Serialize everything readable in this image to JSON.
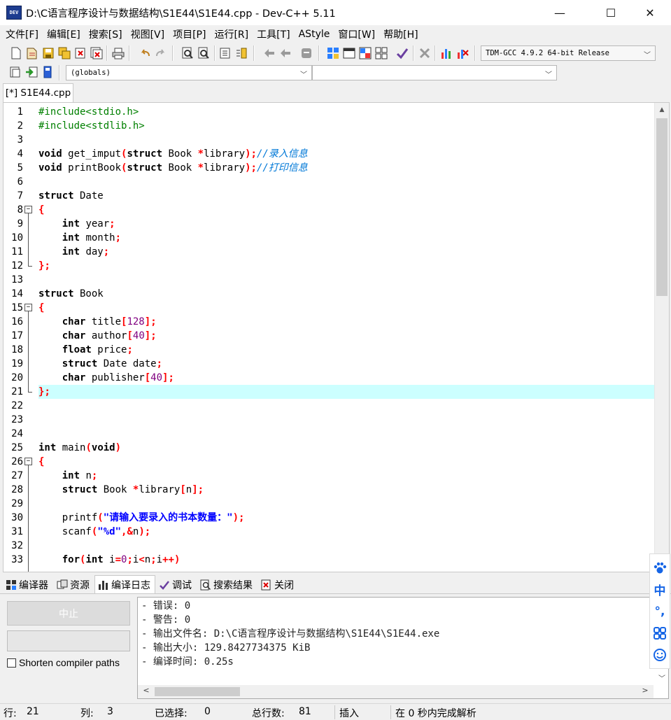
{
  "window": {
    "title": "D:\\C语言程序设计与数据结构\\S1E44\\S1E44.cpp - Dev-C++ 5.11",
    "icon_text": "DEV",
    "minimize": "—",
    "maximize": "☐",
    "close": "✕"
  },
  "menu": [
    "文件[F]",
    "编辑[E]",
    "搜索[S]",
    "视图[V]",
    "项目[P]",
    "运行[R]",
    "工具[T]",
    "AStyle",
    "窗口[W]",
    "帮助[H]"
  ],
  "toolbar": {
    "compiler_selected": "TDM-GCC 4.9.2 64-bit Release",
    "scope_selected": "(globals)",
    "member_selected": ""
  },
  "editor": {
    "tab_label": "[*] S1E44.cpp",
    "active_line": 21,
    "line_numbers": [
      "1",
      "2",
      "3",
      "4",
      "5",
      "6",
      "7",
      "8",
      "9",
      "10",
      "11",
      "12",
      "13",
      "14",
      "15",
      "16",
      "17",
      "18",
      "19",
      "20",
      "21",
      "22",
      "23",
      "24",
      "25",
      "26",
      "27",
      "28",
      "29",
      "30",
      "31",
      "32",
      "33"
    ],
    "lines": [
      "#include<stdio.h>",
      "#include<stdlib.h>",
      "",
      "void get_imput(struct Book *library);//录入信息",
      "void printBook(struct Book *library);//打印信息",
      "",
      "struct Date",
      "{",
      "    int year;",
      "    int month;",
      "    int day;",
      "};",
      "",
      "struct Book",
      "{",
      "    char title[128];",
      "    char author[40];",
      "    float price;",
      "    struct Date date;",
      "    char publisher[40];",
      "};",
      "",
      "",
      "",
      "int main(void)",
      "{",
      "    int n;",
      "    struct Book *library[n];",
      "",
      "    printf(\"请输入要录入的书本数量：\");",
      "    scanf(\"%d\",&n);",
      "",
      "    for(int i=0;i<n;i++)"
    ]
  },
  "bottom_tabs": [
    {
      "label": "编译器",
      "icon": "compiler-grid-icon"
    },
    {
      "label": "资源",
      "icon": "resources-icon"
    },
    {
      "label": "编译日志",
      "icon": "chart-icon"
    },
    {
      "label": "调试",
      "icon": "check-icon"
    },
    {
      "label": "搜索结果",
      "icon": "search-doc-icon"
    },
    {
      "label": "关闭",
      "icon": "close-doc-icon"
    }
  ],
  "compile_log": {
    "stop_label": "中止",
    "shorten_label": "Shorten compiler paths",
    "lines": [
      "- 错误: 0",
      "- 警告: 0",
      "- 输出文件名: D:\\C语言程序设计与数据结构\\S1E44\\S1E44.exe",
      "- 输出大小: 129.8427734375 KiB",
      "- 编译时间: 0.25s"
    ]
  },
  "ime": [
    "paw-icon",
    "中",
    "°,",
    "grid-icon",
    "smile-icon"
  ],
  "statusbar": {
    "row_label": "行:",
    "row_value": "21",
    "col_label": "列:",
    "col_value": "3",
    "sel_label": "已选择:",
    "sel_value": "0",
    "total_label": "总行数:",
    "total_value": "81",
    "mode": "插入",
    "parse_msg": "在 0 秒内完成解析"
  }
}
